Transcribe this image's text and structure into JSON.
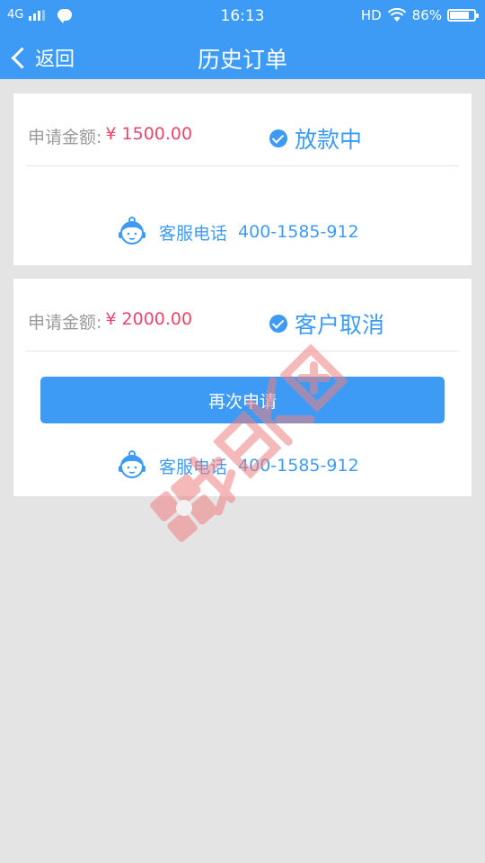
{
  "status_bar": {
    "network": "4G",
    "time": "16:13",
    "hd": "HD",
    "battery": "86%",
    "battery_level": 0.86
  },
  "nav": {
    "back_label": "返回",
    "title": "历史订单"
  },
  "orders": [
    {
      "amount_label": "申请金额:",
      "amount_value": "¥ 1500.00",
      "status": "放款中",
      "service_label": "客服电话",
      "service_phone": "400-1585-912"
    },
    {
      "amount_label": "申请金额:",
      "amount_value": "¥ 2000.00",
      "status": "客户取消",
      "button_label": "再次申请",
      "service_label": "客服电话",
      "service_phone": "400-1585-912"
    }
  ],
  "colors": {
    "brand": "#3d9bf5",
    "amount": "#e8456a",
    "background": "#e4e4e4",
    "watermark": "#f08080"
  }
}
